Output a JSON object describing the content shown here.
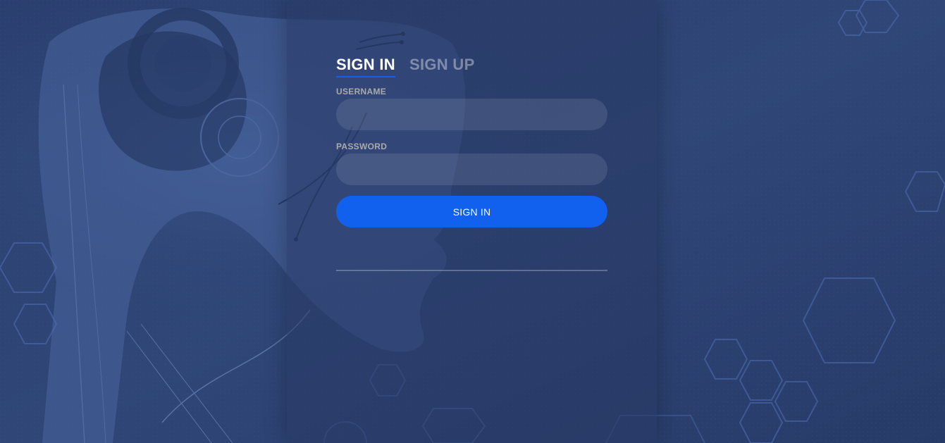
{
  "tabs": {
    "sign_in": "SIGN IN",
    "sign_up": "SIGN UP"
  },
  "form": {
    "username_label": "USERNAME",
    "username_value": "",
    "password_label": "PASSWORD",
    "password_value": "",
    "submit_label": "SIGN IN"
  },
  "colors": {
    "accent": "#1161ee",
    "background": "#2b4170",
    "label": "#aaaaaa"
  },
  "background_art": "robot-head-hexagon-circuit"
}
